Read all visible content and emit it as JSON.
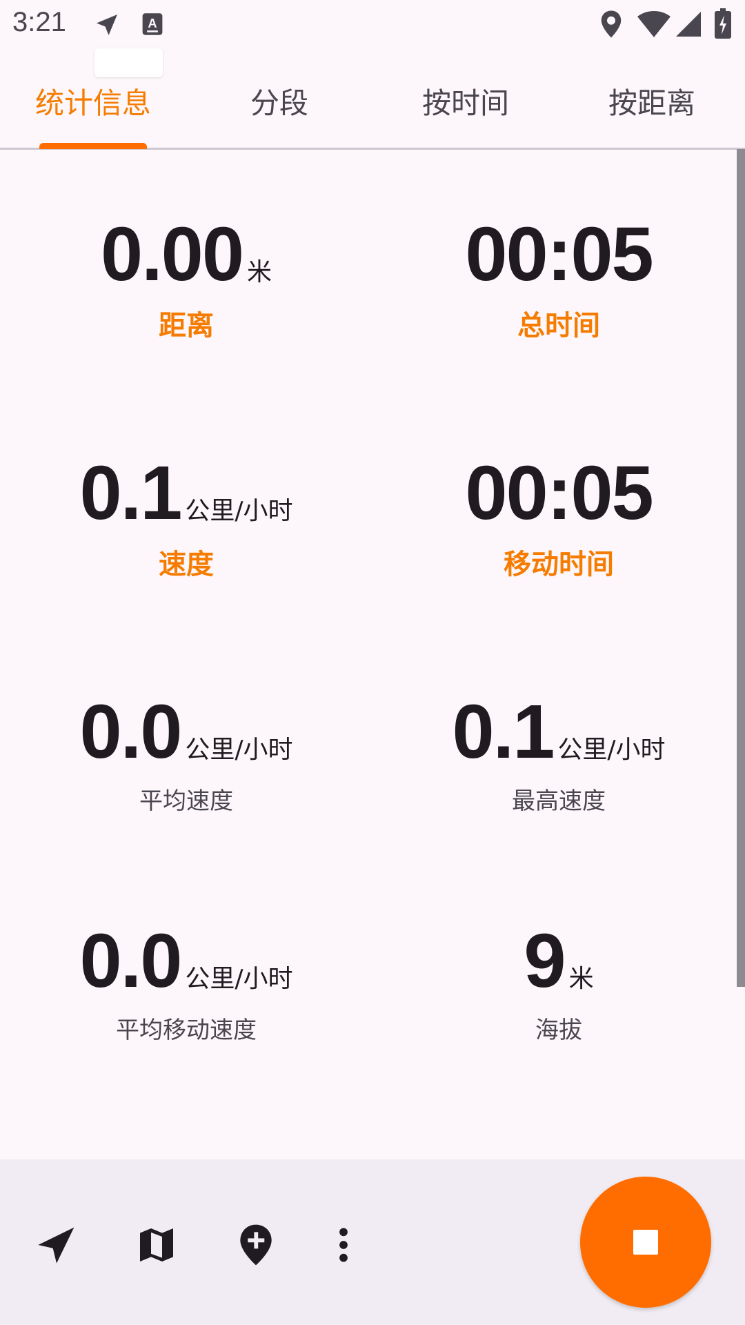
{
  "status_bar": {
    "time": "3:21",
    "icons": [
      "navigation-arrow-icon",
      "text-a-icon",
      "location-pin-icon",
      "wifi-icon",
      "cell-signal-icon",
      "battery-charging-icon"
    ]
  },
  "tabs": [
    {
      "label": "统计信息",
      "active": true
    },
    {
      "label": "分段",
      "active": false
    },
    {
      "label": "按时间",
      "active": false
    },
    {
      "label": "按距离",
      "active": false
    }
  ],
  "stats": {
    "distance": {
      "value": "0.00",
      "unit": "米",
      "label": "距离"
    },
    "total_time": {
      "value": "00:05",
      "unit": "",
      "label": "总时间"
    },
    "speed": {
      "value": "0.1",
      "unit": "公里/小时",
      "label": "速度"
    },
    "moving_time": {
      "value": "00:05",
      "unit": "",
      "label": "移动时间"
    },
    "avg_speed": {
      "value": "0.0",
      "unit": "公里/小时",
      "label": "平均速度"
    },
    "max_speed": {
      "value": "0.1",
      "unit": "公里/小时",
      "label": "最高速度"
    },
    "avg_moving_speed": {
      "value": "0.0",
      "unit": "公里/小时",
      "label": "平均移动速度"
    },
    "elevation": {
      "value": "9",
      "unit": "米",
      "label": "海拔"
    }
  },
  "bottom_bar": {
    "icons": [
      "navigation-arrow-icon",
      "map-icon",
      "add-marker-icon",
      "more-vert-icon"
    ],
    "fab_icon": "stop-icon"
  },
  "colors": {
    "accent": "#ff6d00",
    "accent_text": "#f57c00",
    "background": "#fdf7fb",
    "bottom_bar": "#f1ecf3"
  }
}
